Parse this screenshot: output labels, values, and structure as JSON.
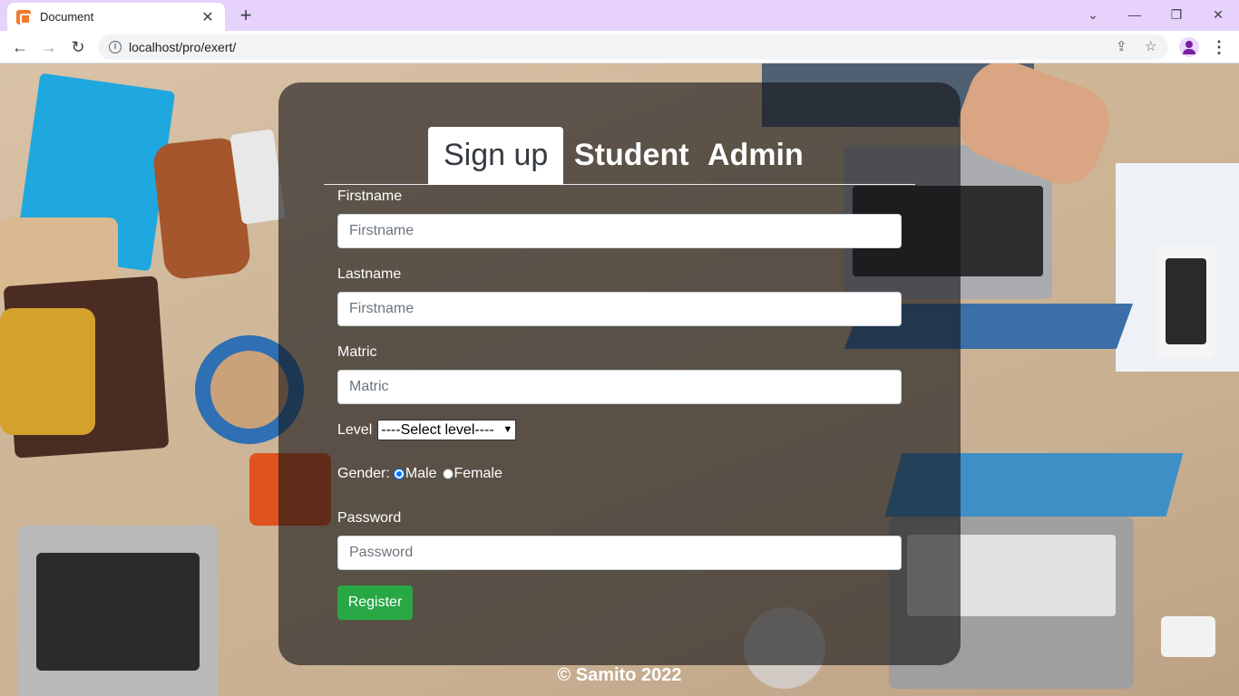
{
  "browser": {
    "tab_title": "Document",
    "tab_close": "✕",
    "new_tab": "+",
    "url": "localhost/pro/exert/",
    "back": "←",
    "forward": "→",
    "reload": "↻",
    "minimize": "—",
    "maximize": "❐",
    "close": "✕",
    "tab_search": "⌄",
    "share": "⇪",
    "bookmark": "☆",
    "menu": "⋮"
  },
  "form": {
    "tabs": [
      {
        "label": "Sign up",
        "active": true
      },
      {
        "label": "Student",
        "active": false
      },
      {
        "label": "Admin",
        "active": false
      }
    ],
    "firstname_label": "Firstname",
    "firstname_placeholder": "Firstname",
    "lastname_label": "Lastname",
    "lastname_placeholder": "Firstname",
    "matric_label": "Matric",
    "matric_placeholder": "Matric",
    "level_label": "Level",
    "level_selected": "----Select level----",
    "gender_label": "Gender:",
    "gender_options": [
      {
        "label": "Male",
        "checked": true
      },
      {
        "label": "Female",
        "checked": false
      }
    ],
    "password_label": "Password",
    "password_placeholder": "Password",
    "register_label": "Register"
  },
  "footer": {
    "text": "© Samito 2022"
  },
  "colors": {
    "register": "#28a745",
    "card_overlay": "rgba(20,20,22,0.62)",
    "chrome_tabbar": "#e6d2fb"
  }
}
